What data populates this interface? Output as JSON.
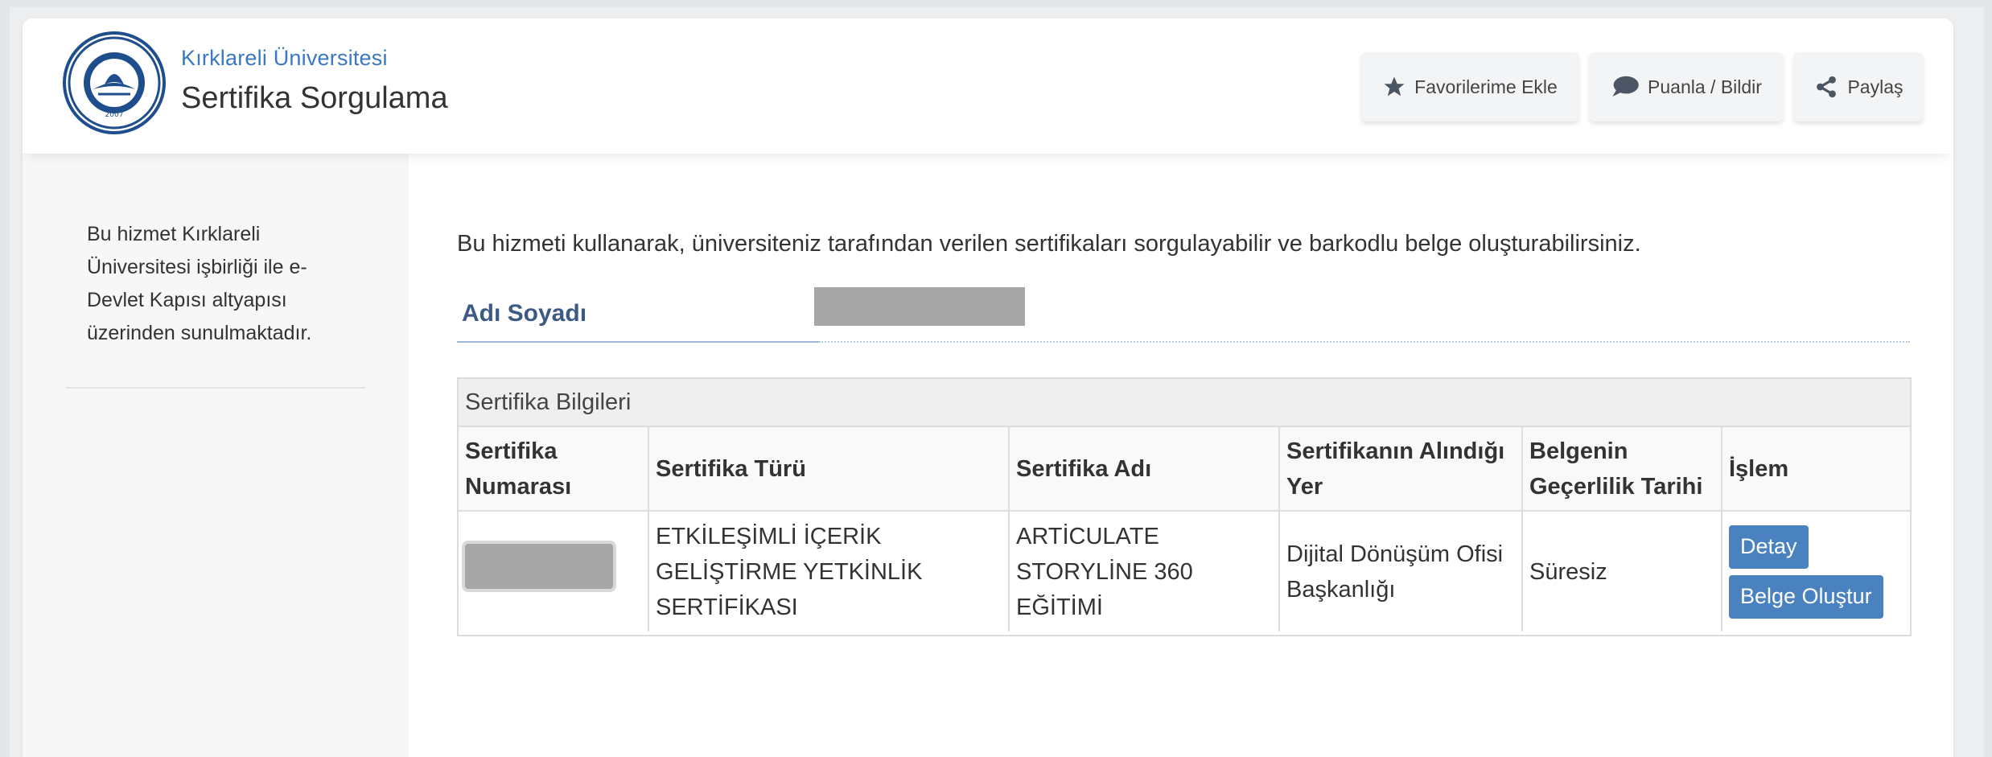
{
  "header": {
    "org_name": "Kırklareli Üniversitesi",
    "title": "Sertifika Sorgulama",
    "buttons": {
      "favorite": "Favorilerime Ekle",
      "rate": "Puanla / Bildir",
      "share": "Paylaş"
    },
    "icons": {
      "favorite": "star-icon",
      "rate": "speech-bubble-icon",
      "share": "share-icon"
    }
  },
  "sidebar": {
    "text": "Bu hizmet Kırklareli Üniversitesi işbirliği ile e-Devlet Kapısı altyapısı üzerinden sunulmaktadır."
  },
  "main": {
    "intro": "Bu hizmeti kullanarak, üniversiteniz tarafından verilen sertifikaları sorgulayabilir ve barkodlu belge oluşturabilirsiniz.",
    "name_label": "Adı Soyadı",
    "panel_title": "Sertifika Bilgileri",
    "table": {
      "headers": [
        "Sertifika Numarası",
        "Sertifika Türü",
        "Sertifika Adı",
        "Sertifikanın Alındığı Yer",
        "Belgenin Geçerlilik Tarihi",
        "İşlem"
      ],
      "rows": [
        {
          "type": "ETKİLEŞİMLİ İÇERİK GELİŞTİRME YETKİNLİK SERTİFİKASI",
          "name": "ARTİCULATE STORYLİNE 360 EĞİTİMİ",
          "place": "Dijital Dönüşüm Ofisi Başkanlığı",
          "validity": "Süresiz",
          "actions": {
            "detail": "Detay",
            "create": "Belge Oluştur"
          }
        }
      ]
    }
  },
  "colors": {
    "accent": "#3a78c3",
    "button_blue": "#4a82bf",
    "label_blue": "#3b5a85"
  }
}
